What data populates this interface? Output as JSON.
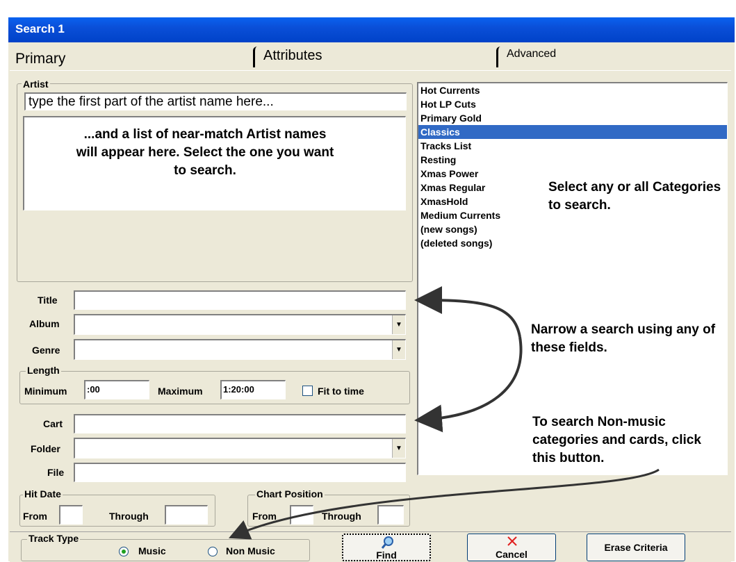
{
  "window": {
    "title": "Search 1"
  },
  "tabs": [
    {
      "label": "Primary"
    },
    {
      "label": "Attributes"
    },
    {
      "label": "Advanced"
    }
  ],
  "artist": {
    "label": "Artist",
    "input_value": "type the first part of the artist name here...",
    "list_hint": "...and a list of near-match Artist names will appear here.  Select the one you want to search."
  },
  "fields": {
    "title_label": "Title",
    "album_label": "Album",
    "genre_label": "Genre",
    "cart_label": "Cart",
    "folder_label": "Folder",
    "file_label": "File"
  },
  "length": {
    "label": "Length",
    "minimum_label": "Minimum",
    "minimum_value": ":00",
    "maximum_label": "Maximum",
    "maximum_value": "1:20:00",
    "fit_label": "Fit to time"
  },
  "hit_date": {
    "label": "Hit Date",
    "from_label": "From",
    "through_label": "Through"
  },
  "chart_position": {
    "label": "Chart Position",
    "from_label": "From",
    "through_label": "Through"
  },
  "categories": {
    "items": [
      "Hot Currents",
      "Hot LP Cuts",
      "Primary Gold",
      "Classics",
      "Tracks List",
      "Resting",
      "Xmas Power",
      "Xmas Regular",
      "XmasHold",
      "Medium Currents",
      "(new songs)",
      "(deleted songs)"
    ],
    "selected": "Classics"
  },
  "annotations": {
    "categories_hint": "Select any or all Categories to search.",
    "narrow_hint": "Narrow a search using any of these fields.",
    "nonmusic_hint": "To search Non-music categories and cards, click this button."
  },
  "track_type": {
    "label": "Track Type",
    "music_label": "Music",
    "nonmusic_label": "Non Music",
    "selected": "Music"
  },
  "buttons": {
    "find": "Find",
    "cancel": "Cancel",
    "erase": "Erase Criteria"
  },
  "colors": {
    "title_bar": "#0a4fd8",
    "selection": "#316ac5",
    "dialog_bg": "#ece9d8"
  },
  "icons": {
    "find": "magnifier-icon",
    "cancel": "red-x-icon"
  }
}
